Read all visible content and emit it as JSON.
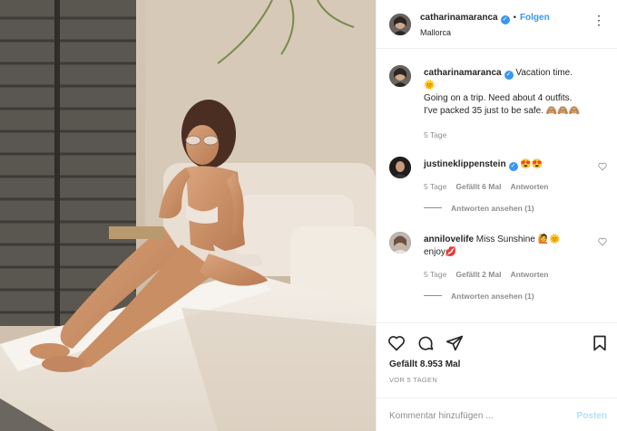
{
  "header": {
    "username": "catharinamaranca",
    "follow_label": "Folgen",
    "location": "Mallorca",
    "more_icon": "more-dots-icon"
  },
  "caption": {
    "username": "catharinamaranca",
    "text_line1": "Vacation time.",
    "text_line2": "Going on a trip. Need about 4 outfits.",
    "text_line3": "I've packed 35 just to be safe. 🙈🙈🙈",
    "time": "5 Tage"
  },
  "comments": [
    {
      "username": "justineklippenstein",
      "text": "😍😍",
      "time": "5 Tage",
      "likes": "Gefällt 6 Mal",
      "reply_label": "Antworten",
      "view_replies": "Antworten ansehen (1)"
    },
    {
      "username": "annilovelife",
      "text_line1": "Miss Sunshine 🙋🌞",
      "text_line2": "enjoy💋",
      "time": "5 Tage",
      "likes": "Gefällt 2 Mal",
      "reply_label": "Antworten",
      "view_replies": "Antworten ansehen (1)"
    }
  ],
  "actions": {
    "likes_count": "Gefällt 8.953 Mal",
    "posted_ago": "VOR 5 TAGEN",
    "comment_placeholder": "Kommentar hinzufügen ...",
    "post_label": "Posten"
  },
  "colors": {
    "accent": "#3897f0",
    "post_disabled": "#b2dffc",
    "muted": "#8e8e8e"
  }
}
